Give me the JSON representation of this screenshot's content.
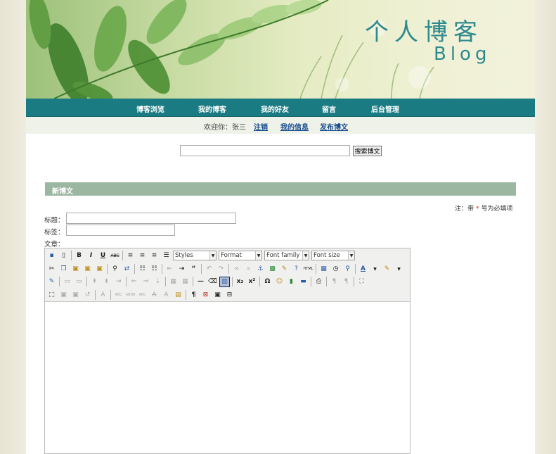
{
  "banner": {
    "title": "个人博客",
    "subtitle": "Blog"
  },
  "nav": {
    "items": [
      "博客浏览",
      "我的博客",
      "我的好友",
      "留言",
      "后台管理"
    ]
  },
  "userbar": {
    "greeting": "欢迎你：张三",
    "links": [
      "注销",
      "我的信息",
      "发布博文"
    ]
  },
  "search": {
    "value": "",
    "button_label": "搜索博文"
  },
  "section": {
    "title": "新博文"
  },
  "note": {
    "prefix": "注：带",
    "star": "*",
    "suffix": "号为必填项"
  },
  "form": {
    "title_label": "标题：",
    "tags_label": "标签：",
    "content_label": "文章："
  },
  "editor": {
    "styles": "Styles",
    "format": "Format",
    "font_family": "Font family",
    "font_size": "Font size",
    "content": ""
  },
  "colors": {
    "nav": "#1b7b83",
    "section": "#9bb7a1",
    "banner_text": "#2f8a8e",
    "link": "#1a4d8e"
  }
}
